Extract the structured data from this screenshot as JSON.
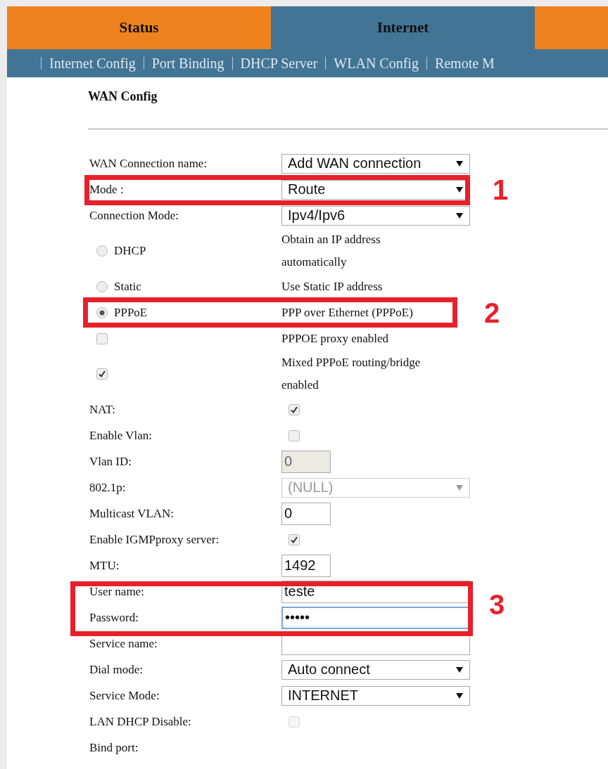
{
  "tabs": [
    {
      "label": "Status",
      "selected": false
    },
    {
      "label": "Internet",
      "selected": true
    }
  ],
  "subnav": [
    "Internet Config",
    "Port Binding",
    "DHCP Server",
    "WLAN Config",
    "Remote M"
  ],
  "section_title": "WAN Config",
  "rows": [
    {
      "kind": "select",
      "label": "WAN Connection name:",
      "value": "Add WAN connection"
    },
    {
      "kind": "callout",
      "number": "1",
      "rows": [
        {
          "kind": "select",
          "label": "Mode :",
          "value": "Route"
        }
      ]
    },
    {
      "kind": "select",
      "label": "Connection Mode:",
      "value": "Ipv4/Ipv6"
    },
    {
      "kind": "radio",
      "label": "DHCP",
      "description": "Obtain an IP address automatically",
      "selected": false
    },
    {
      "kind": "radio",
      "label": "Static",
      "description": "Use Static IP address",
      "selected": false
    },
    {
      "kind": "callout",
      "number": "2",
      "rows": [
        {
          "kind": "radio",
          "label": "PPPoE",
          "description": "PPP over Ethernet (PPPoE)",
          "selected": true
        }
      ]
    },
    {
      "kind": "option_checkbox",
      "description": "PPPOE proxy enabled",
      "checked": false
    },
    {
      "kind": "option_checkbox",
      "description": "Mixed PPPoE routing/bridge enabled",
      "checked": true
    },
    {
      "kind": "checkbox",
      "label": "NAT:",
      "checked": true
    },
    {
      "kind": "checkbox",
      "label": "Enable Vlan:",
      "checked": false
    },
    {
      "kind": "short_input",
      "label": "Vlan ID:",
      "value": "0",
      "disabled": true
    },
    {
      "kind": "select",
      "label": "802.1p:",
      "value": "(NULL)",
      "disabled": true
    },
    {
      "kind": "short_input",
      "label": "Multicast VLAN:",
      "value": "0"
    },
    {
      "kind": "checkbox",
      "label": "Enable IGMPproxy server:",
      "checked": true
    },
    {
      "kind": "short_input",
      "label": "MTU:",
      "value": "1492"
    },
    {
      "kind": "callout",
      "number": "3",
      "rows": [
        {
          "kind": "input",
          "label": "User name:",
          "value": "teste"
        },
        {
          "kind": "input",
          "label": "Password:",
          "value": "•••••",
          "focused": true
        }
      ]
    },
    {
      "kind": "input",
      "label": "Service name:"
    },
    {
      "kind": "select",
      "label": "Dial mode:",
      "value": "Auto connect"
    },
    {
      "kind": "select",
      "label": "Service Mode:",
      "value": "INTERNET"
    },
    {
      "kind": "checkbox",
      "label": "LAN DHCP Disable:",
      "checked": false,
      "disabled": true
    },
    {
      "kind": "label",
      "label": "Bind port:"
    }
  ]
}
